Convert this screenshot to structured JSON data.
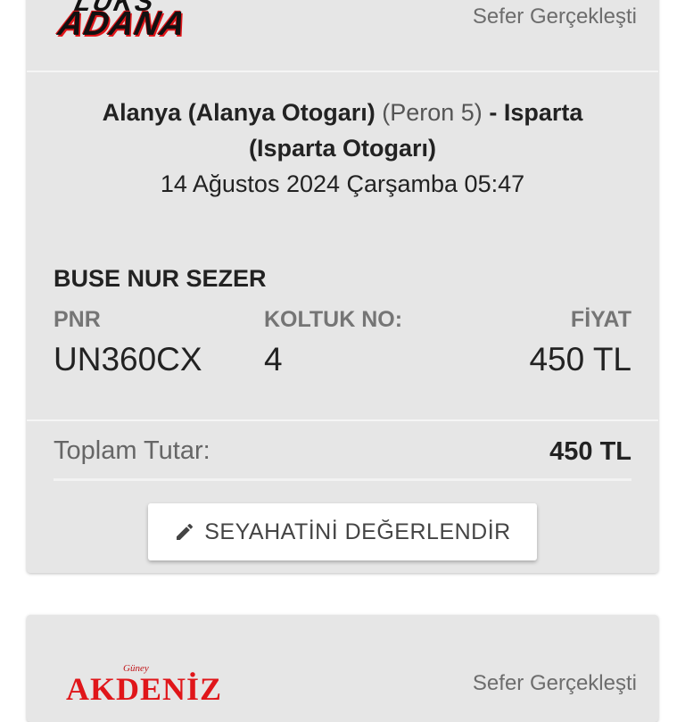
{
  "cards": [
    {
      "logo": {
        "line1": "LÜKS",
        "line2": "ADANA"
      },
      "status": "Sefer Gerçekleşti",
      "route": {
        "from_city": "Alanya",
        "from_station": "(Alanya Otogarı)",
        "platform": "(Peron 5)",
        "separator": "-",
        "to_city": "Isparta",
        "to_station": "(Isparta Otogarı)",
        "datetime": "14 Ağustos 2024 Çarşamba 05:47"
      },
      "passenger_name": "BUSE NUR SEZER",
      "pnr_label": "PNR",
      "pnr_value": "UN360CX",
      "seat_label": "KOLTUK NO:",
      "seat_value": "4",
      "price_label": "FİYAT",
      "price_value": "450 TL",
      "total_label": "Toplam Tutar:",
      "total_value": "450 TL",
      "rate_button_label": "SEYAHATİNİ DEĞERLENDİR",
      "rate_button_icon": "pencil-icon"
    },
    {
      "logo": {
        "line1": "Güney",
        "line2": "AKDENİZ"
      },
      "status": "Sefer Gerçekleşti"
    }
  ],
  "colors": {
    "card_background": "#e6e6e6",
    "logo_red": "#e0161a",
    "muted_text": "#757575"
  }
}
